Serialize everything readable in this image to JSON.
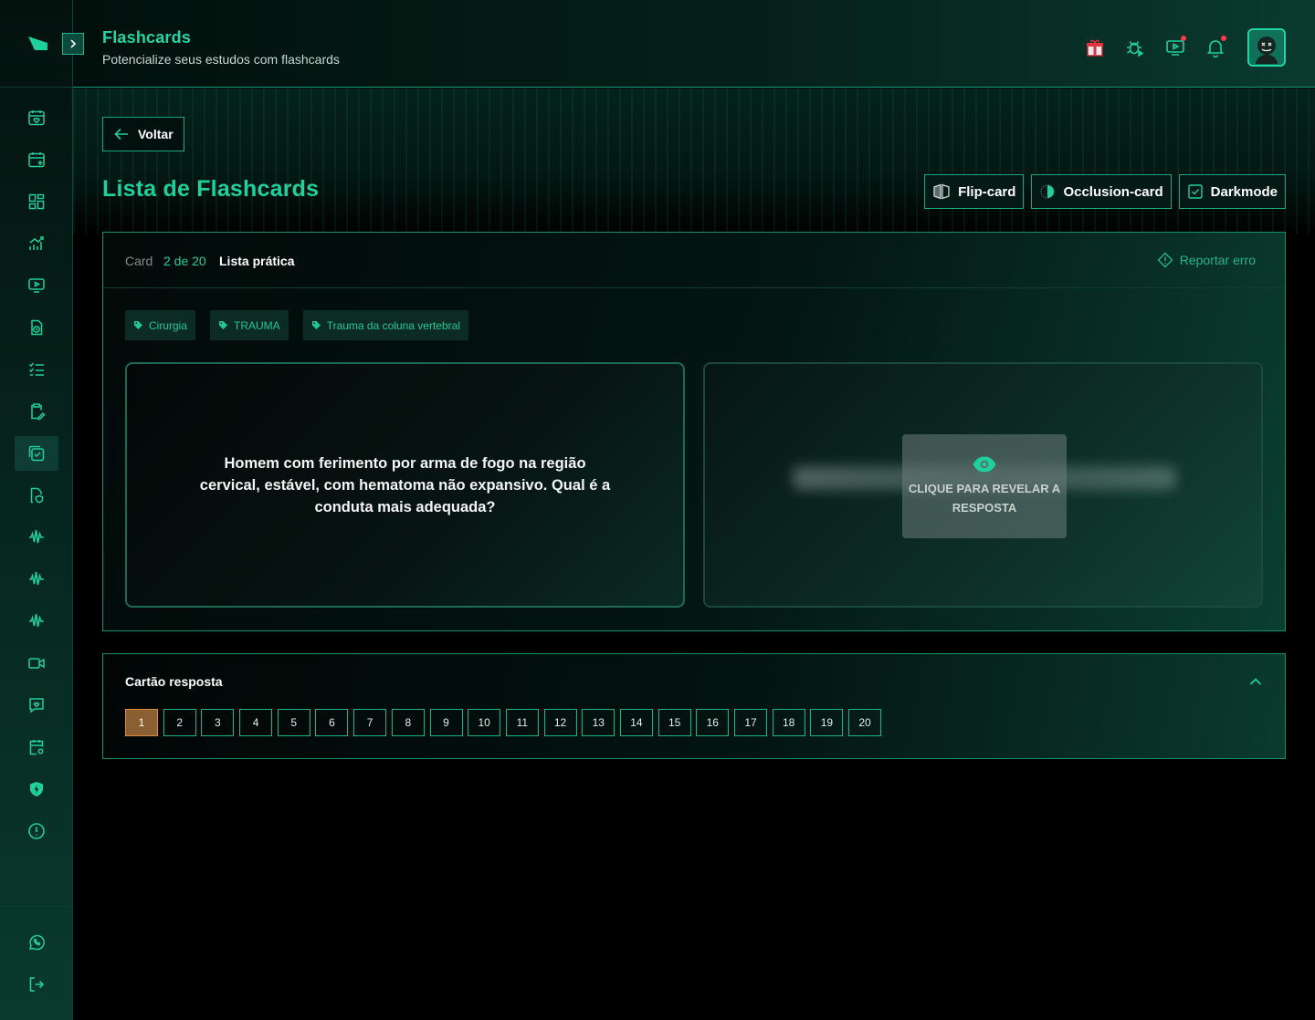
{
  "header": {
    "title": "Flashcards",
    "subtitle": "Potencialize seus estudos com flashcards",
    "icons": [
      "gift-icon",
      "bug-icon",
      "video-icon",
      "bell-icon"
    ],
    "has_notifications": true
  },
  "sidebar": {
    "items": [
      {
        "icon": "calendar-heart-icon"
      },
      {
        "icon": "calendar-plus-icon"
      },
      {
        "icon": "dashboard-grid-icon"
      },
      {
        "icon": "chart-up-icon"
      },
      {
        "icon": "video-screen-icon"
      },
      {
        "icon": "document-clock-icon"
      },
      {
        "icon": "checklist-icon"
      },
      {
        "icon": "clipboard-edit-icon"
      },
      {
        "icon": "flashcards-check-icon",
        "active": true
      },
      {
        "icon": "document-shield-icon"
      },
      {
        "icon": "waveform-icon"
      },
      {
        "icon": "waveform-icon"
      },
      {
        "icon": "waveform-icon"
      },
      {
        "icon": "camera-icon"
      },
      {
        "icon": "chat-heart-icon"
      },
      {
        "icon": "calendar-settings-icon"
      },
      {
        "icon": "shield-bolt-icon"
      },
      {
        "icon": "alert-circle-icon"
      }
    ],
    "bottom": [
      {
        "icon": "whatsapp-icon"
      },
      {
        "icon": "logout-icon"
      }
    ]
  },
  "main": {
    "back_label": "Voltar",
    "page_title": "Lista de Flashcards",
    "modes": [
      {
        "label": "Flip-card",
        "icon": "flip-card-icon"
      },
      {
        "label": "Occlusion-card",
        "icon": "occlusion-icon"
      },
      {
        "label": "Darkmode",
        "icon": "checkbox-icon"
      }
    ],
    "card": {
      "card_label": "Card",
      "count": "2 de 20",
      "list_name": "Lista prática",
      "report_label": "Reportar erro",
      "tags": [
        "Cirurgia",
        "TRAUMA",
        "Trauma da coluna vertebral"
      ],
      "question": "Homem com ferimento por arma de fogo na região cervical, estável, com hematoma não expansivo. Qual é a conduta mais adequada?",
      "reveal_label": "Clique para revelar a resposta"
    },
    "answer_sheet": {
      "title": "Cartão resposta",
      "current": "1",
      "numbers": [
        "1",
        "2",
        "3",
        "4",
        "5",
        "6",
        "7",
        "8",
        "9",
        "10",
        "11",
        "12",
        "13",
        "14",
        "15",
        "16",
        "17",
        "18",
        "19",
        "20"
      ]
    }
  },
  "colors": {
    "accent": "#1fcf9c",
    "border": "#168e70",
    "current_number": "#e08a3c",
    "notification_dot": "#ff3b4a"
  }
}
